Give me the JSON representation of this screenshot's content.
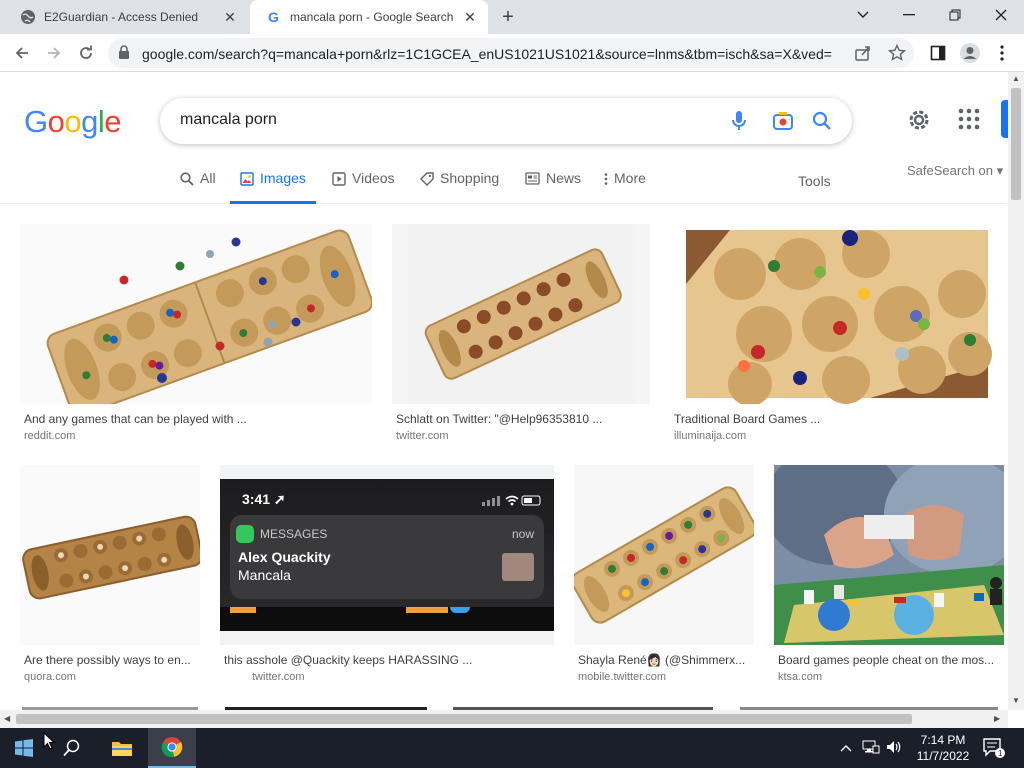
{
  "browser": {
    "tabs": [
      {
        "title": "E2Guardian - Access Denied",
        "active": false
      },
      {
        "title": "mancala porn - Google Search",
        "active": true
      }
    ],
    "url": "google.com/search?q=mancala+porn&rlz=1C1GCEA_enUS1021US1021&source=lnms&tbm=isch&sa=X&ved=2..."
  },
  "google": {
    "logo_letters": [
      {
        "ch": "G",
        "color": "#4285f4"
      },
      {
        "ch": "o",
        "color": "#ea4335"
      },
      {
        "ch": "o",
        "color": "#fbbc05"
      },
      {
        "ch": "g",
        "color": "#4285f4"
      },
      {
        "ch": "l",
        "color": "#34a853"
      },
      {
        "ch": "e",
        "color": "#ea4335"
      }
    ],
    "query": "mancala porn",
    "nav": [
      {
        "label": "All",
        "icon": "search-icon"
      },
      {
        "label": "Images",
        "icon": "image-icon",
        "active": true
      },
      {
        "label": "Videos",
        "icon": "play-icon"
      },
      {
        "label": "Shopping",
        "icon": "tag-icon"
      },
      {
        "label": "News",
        "icon": "news-icon"
      },
      {
        "label": "More",
        "icon": "more-vert-icon"
      }
    ],
    "tools": "Tools",
    "safesearch": "SafeSearch on"
  },
  "results": [
    {
      "caption": "And any games that can be played with ...",
      "source": "reddit.com"
    },
    {
      "caption": "Schlatt on Twitter: \"@Help96353810 ...",
      "source": "twitter.com"
    },
    {
      "caption": "Traditional Board Games ...",
      "source": "illuminaija.com"
    },
    {
      "caption": "Are there possibly ways to en...",
      "source": "quora.com"
    },
    {
      "caption": "this asshole @Quackity keeps HARASSING ...",
      "source": "twitter.com"
    },
    {
      "caption": "Shayla René👩🏻 (@Shimmerx...",
      "source": "mobile.twitter.com"
    },
    {
      "caption": "Board games people cheat on the mos...",
      "source": "ktsa.com"
    }
  ],
  "phone_notification": {
    "time": "3:41",
    "app": "MESSAGES",
    "when": "now",
    "sender": "Alex Quackity",
    "message": "Mancala"
  },
  "taskbar": {
    "time": "7:14 PM",
    "date": "11/7/2022",
    "notifications": "1"
  }
}
